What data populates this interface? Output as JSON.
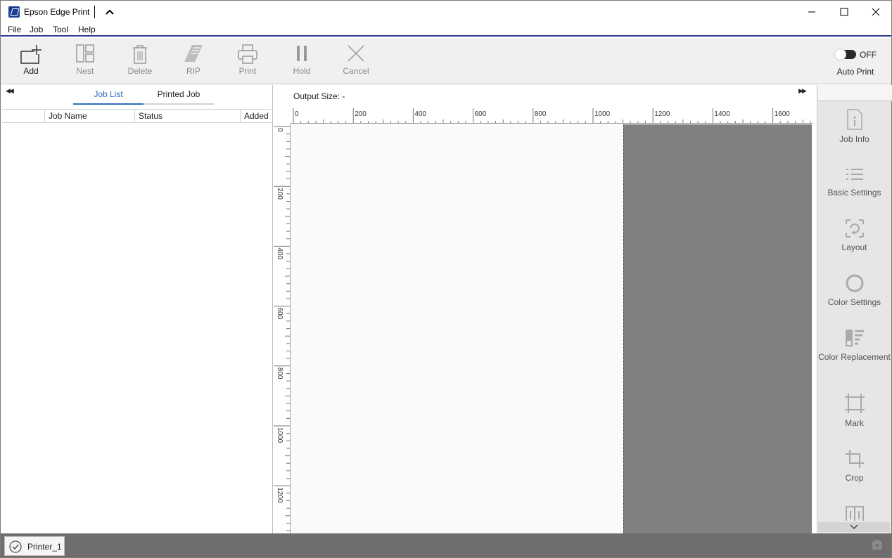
{
  "window": {
    "title": "Epson Edge Print"
  },
  "menu": [
    "File",
    "Job",
    "Tool",
    "Help"
  ],
  "toolbar": {
    "add": "Add",
    "nest": "Nest",
    "delete": "Delete",
    "rip": "RIP",
    "print": "Print",
    "hold": "Hold",
    "cancel": "Cancel",
    "auto_print_state": "OFF",
    "auto_print_label": "Auto Print"
  },
  "left_panel": {
    "tabs": [
      "Job List",
      "Printed Job"
    ],
    "active_tab": "Job List",
    "columns": [
      "Job Name",
      "Status",
      "Added"
    ],
    "rows": []
  },
  "preview": {
    "output_size": "Output Size:  -",
    "h_ruler_labels": [
      "0",
      "200",
      "400",
      "600",
      "800",
      "1000",
      "1200",
      "1400",
      "1600"
    ],
    "v_ruler_labels": [
      "0",
      "200",
      "400",
      "600",
      "800",
      "1000",
      "1200"
    ]
  },
  "right_panel": {
    "items": [
      {
        "label": "Job Info",
        "icon": "job-info-icon"
      },
      {
        "label": "Basic Settings",
        "icon": "basic-settings-icon"
      },
      {
        "label": "Layout",
        "icon": "layout-icon"
      },
      {
        "label": "Color Settings",
        "icon": "color-settings-icon"
      },
      {
        "label": "Color Replacement",
        "icon": "color-replacement-icon"
      },
      {
        "label": "Mark",
        "icon": "mark-icon"
      },
      {
        "label": "Crop",
        "icon": "crop-icon"
      }
    ]
  },
  "statusbar": {
    "printer": "Printer_1"
  },
  "colors": {
    "accent": "#2d6bc0",
    "menu_underline": "#2b3b8f",
    "media_gray": "#808080",
    "statusbar": "#6e6e6e"
  }
}
